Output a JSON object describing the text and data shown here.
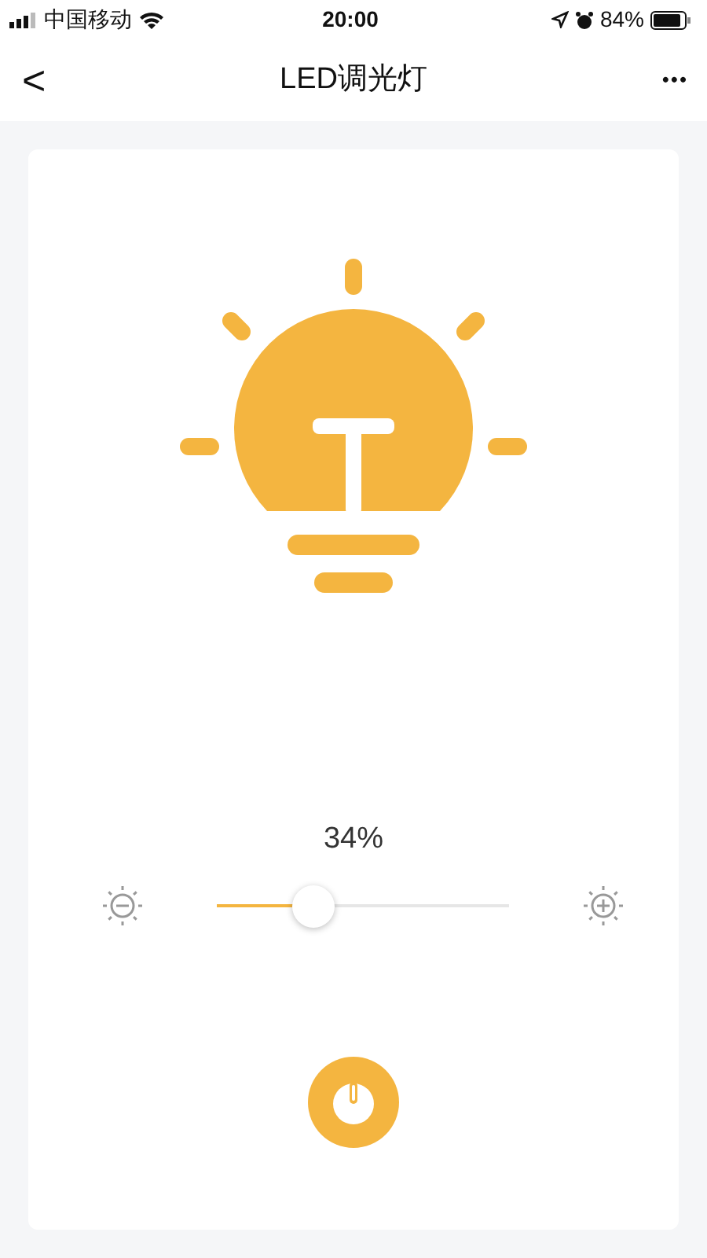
{
  "status_bar": {
    "carrier": "中国移动",
    "time": "20:00",
    "battery": "84%"
  },
  "nav": {
    "back": "<",
    "title": "LED调光灯",
    "more": "•••"
  },
  "light": {
    "on": true
  },
  "brightness": {
    "reading": "34%",
    "level": 0.33
  }
}
